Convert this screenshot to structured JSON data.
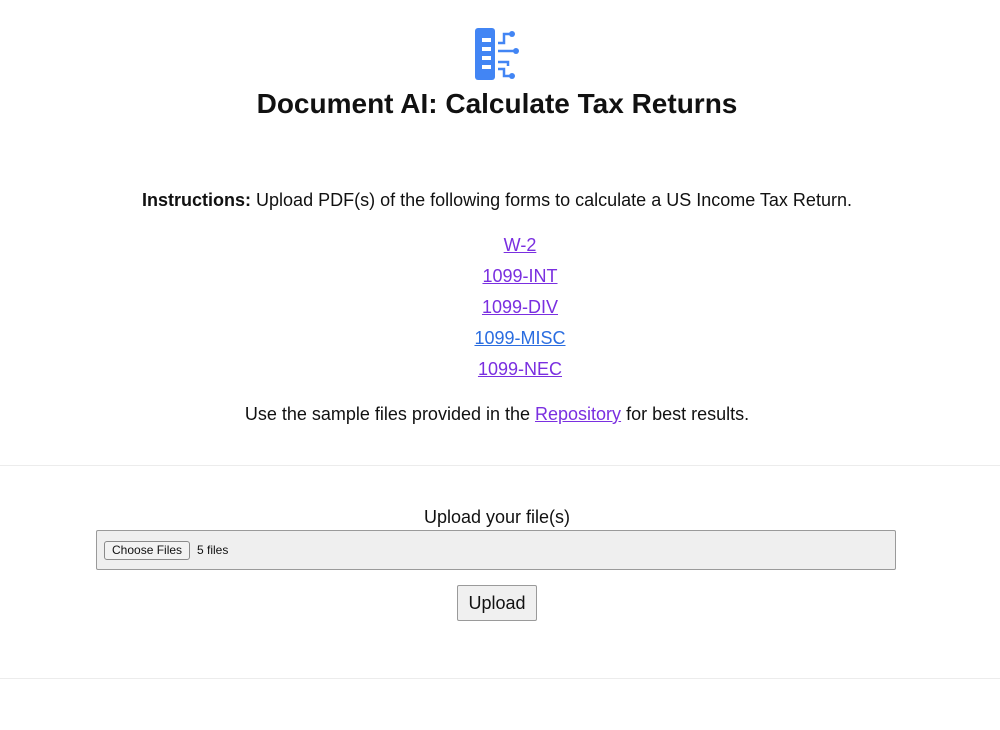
{
  "header": {
    "logo_icon": "document-ai-icon",
    "title": "Document AI: Calculate Tax Returns"
  },
  "instructions": {
    "label": "Instructions:",
    "text": " Upload PDF(s) of the following forms to calculate a US Income Tax Return."
  },
  "forms": [
    {
      "label": "W-2"
    },
    {
      "label": "1099-INT"
    },
    {
      "label": "1099-DIV"
    },
    {
      "label": "1099-MISC"
    },
    {
      "label": "1099-NEC"
    }
  ],
  "repository": {
    "prefix": "Use the sample files provided in the ",
    "link": "Repository",
    "suffix": " for best results."
  },
  "upload": {
    "label": "Upload your file(s)",
    "choose_button": "Choose Files",
    "file_status": "5 files",
    "submit_button": "Upload"
  },
  "colors": {
    "logo_blue": "#4285f4",
    "link_visited": "#7a2fe0",
    "link_active": "#2a6de0"
  }
}
